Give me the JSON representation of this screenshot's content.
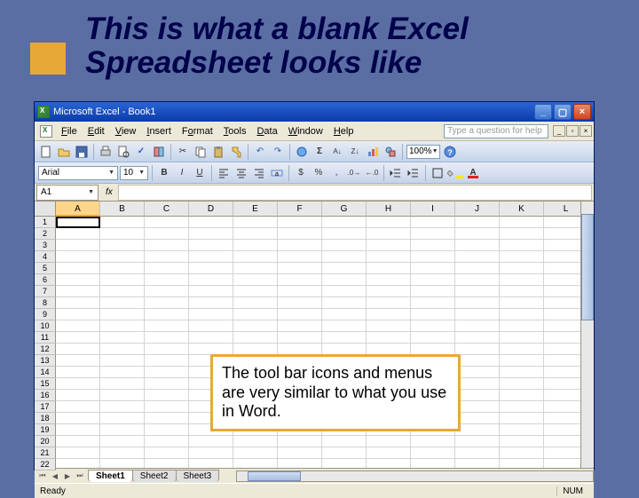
{
  "slide": {
    "title": "This is what a blank Excel Spreadsheet looks like",
    "annotation": "The tool bar icons and menus are very similar to what you use in Word."
  },
  "titlebar": {
    "text": "Microsoft Excel - Book1"
  },
  "menus": {
    "file": "File",
    "edit": "Edit",
    "view": "View",
    "insert": "Insert",
    "format": "Format",
    "tools": "Tools",
    "data": "Data",
    "window": "Window",
    "help": "Help",
    "help_placeholder": "Type a question for help"
  },
  "toolbar": {
    "zoom": "100%"
  },
  "format": {
    "font": "Arial",
    "size": "10",
    "bold": "B",
    "italic": "I",
    "underline": "U",
    "currency": "$",
    "percent": "%",
    "comma": ",",
    "font_color_letter": "A"
  },
  "formula": {
    "name_box": "A1",
    "fx": "fx"
  },
  "columns": [
    "A",
    "B",
    "C",
    "D",
    "E",
    "F",
    "G",
    "H",
    "I",
    "J",
    "K",
    "L"
  ],
  "rows": [
    "1",
    "2",
    "3",
    "4",
    "5",
    "6",
    "7",
    "8",
    "9",
    "10",
    "11",
    "12",
    "13",
    "14",
    "15",
    "16",
    "17",
    "18",
    "19",
    "20",
    "21",
    "22"
  ],
  "sheets": {
    "s1": "Sheet1",
    "s2": "Sheet2",
    "s3": "Sheet3"
  },
  "status": {
    "ready": "Ready",
    "num": "NUM"
  }
}
